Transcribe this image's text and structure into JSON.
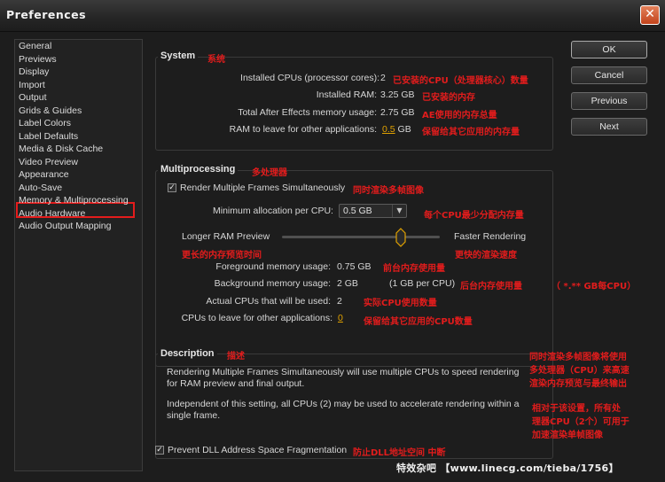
{
  "window": {
    "title": "Preferences",
    "close_glyph": "✕"
  },
  "categories": [
    "General",
    "Previews",
    "Display",
    "Import",
    "Output",
    "Grids & Guides",
    "Label Colors",
    "Label Defaults",
    "Media & Disk Cache",
    "Video Preview",
    "Appearance",
    "Auto-Save",
    "Memory & Multiprocessing",
    "Audio Hardware",
    "Audio Output Mapping"
  ],
  "selected_category": "Memory & Multiprocessing",
  "system": {
    "title": "System",
    "title_note": "系统",
    "installed_cpus_label": "Installed CPUs (processor cores):",
    "installed_cpus_value": "2",
    "installed_cpus_note": "已安装的CPU（处理器核心）数量",
    "installed_ram_label": "Installed RAM:",
    "installed_ram_value": "3.25 GB",
    "installed_ram_note": "已安装的内存",
    "ae_memory_label": "Total After Effects memory usage:",
    "ae_memory_value": "2.75 GB",
    "ae_memory_note": "AE使用的内存总量",
    "ram_leave_label": "RAM to leave for other applications:",
    "ram_leave_value": "0.5",
    "ram_leave_unit": "GB",
    "ram_leave_note": "保留给其它应用的内存量"
  },
  "multiprocessing": {
    "title": "Multiprocessing",
    "title_note": "多处理器",
    "render_multi_label": "Render Multiple Frames Simultaneously",
    "render_multi_checked": true,
    "render_multi_note": "同时渲染多帧图像",
    "min_alloc_label": "Minimum allocation per CPU:",
    "min_alloc_value": "0.5 GB",
    "min_alloc_note": "每个CPU最少分配内存量",
    "slider_left_label": "Longer RAM Preview",
    "slider_right_label": "Faster Rendering",
    "slider_left_note": "更长的内存预览时间",
    "slider_right_note": "更快的渲染速度",
    "slider_position": 0.75,
    "fg_label": "Foreground memory usage:",
    "fg_value": "0.75 GB",
    "fg_note": "前台内存使用量",
    "bg_label": "Background memory usage:",
    "bg_value": "2 GB",
    "bg_extra": "(1 GB per CPU)",
    "bg_note": "后台内存使用量",
    "bg_note2": "（ *.** GB每CPU）",
    "actual_cpus_label": "Actual CPUs that will be used:",
    "actual_cpus_value": "2",
    "actual_cpus_note": "实际CPU使用数量",
    "cpus_leave_label": "CPUs to leave for other applications:",
    "cpus_leave_value": "0",
    "cpus_leave_note": "保留给其它应用的CPU数量"
  },
  "description": {
    "title": "Description",
    "title_note": "描述",
    "para1": "Rendering Multiple Frames Simultaneously will use multiple CPUs to speed rendering for RAM preview and final output.",
    "para2": "Independent of this setting, all CPUs (2) may be used to accelerate rendering within a single frame.",
    "note1": [
      "同时渲染多帧图像将使用",
      "多处理器（CPU）来高速",
      "渲染内存预览与最终输出"
    ],
    "note2": [
      "相对于该设置，所有处",
      "理器CPU（2个）可用于",
      "加速渲染单帧图像"
    ]
  },
  "prevent_dll": {
    "label": "Prevent DLL Address Space Fragmentation",
    "checked": true,
    "note": "防止DLL地址空间 中断"
  },
  "buttons": {
    "ok": "OK",
    "cancel": "Cancel",
    "previous": "Previous",
    "next": "Next"
  },
  "watermark": "特效杂吧 【www.linecg.com/tieba/1756】",
  "colors": {
    "annotation": "#e21c1c",
    "highlight_value": "#e0a100",
    "selection_box": "#e41c1c"
  }
}
